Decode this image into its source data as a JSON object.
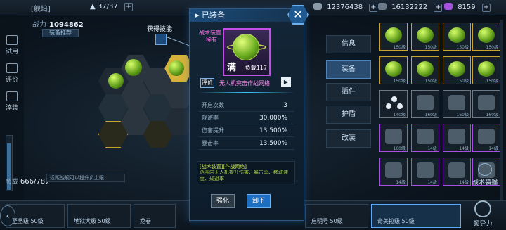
{
  "topbar": {
    "ship_name": "[舰坞]",
    "fleet_count": "37/37",
    "resources": [
      {
        "value": "12376438",
        "color": "#8a9aa8"
      },
      {
        "value": "16132222",
        "color": "#6b7b89"
      },
      {
        "value": "8159",
        "color": "#a64fe0"
      }
    ]
  },
  "left": {
    "nav": [
      "试用",
      "评价",
      "淬装"
    ],
    "power_label": "战力",
    "power_value": "1094862",
    "recommend_label": "装备推荐",
    "load_label": "负载",
    "load_value": "666/787",
    "load_fill_fraction": 0.85,
    "hint_text": "近距战舰可以提升负上限"
  },
  "skill": {
    "label": "获得技能",
    "icon": "skill-snowflake-icon"
  },
  "modal": {
    "title": "已装备",
    "card_type_line1": "战术装置",
    "card_type_line2": "稀有",
    "full_label": "满",
    "capacity_label": "负载117",
    "rate_label": "评价",
    "equipment_name": "无人机突击作战网络",
    "stats": [
      {
        "key": "开启次数",
        "value": "3"
      },
      {
        "key": "规避率",
        "value": "30.000%"
      },
      {
        "key": "伤害提升",
        "value": "13.500%"
      },
      {
        "key": "暴击率",
        "value": "13.500%"
      }
    ],
    "desc_title": "[战术装置][作战网络]",
    "desc_body": "范围内无人机提升伤害、暴击率、移动速度、规避率",
    "strengthen_label": "强化",
    "unequip_label": "卸下"
  },
  "tabs": [
    "信息",
    "装备",
    "插件",
    "护盾",
    "改装"
  ],
  "active_tab": "装备",
  "grid_slots": [
    {
      "type": "gold",
      "lvl": "150级"
    },
    {
      "type": "gold",
      "lvl": "150级"
    },
    {
      "type": "gold",
      "lvl": "150级"
    },
    {
      "type": "gold",
      "lvl": "150级"
    },
    {
      "type": "gold",
      "lvl": "150级"
    },
    {
      "type": "gold",
      "lvl": "150级"
    },
    {
      "type": "gold",
      "lvl": "150级"
    },
    {
      "type": "gold",
      "lvl": "150级"
    },
    {
      "type": "gray",
      "lvl": "140级"
    },
    {
      "type": "gray",
      "lvl": "160级"
    },
    {
      "type": "gray",
      "lvl": "160级"
    },
    {
      "type": "gray",
      "lvl": "160级"
    },
    {
      "type": "purple",
      "lvl": "160级"
    },
    {
      "type": "purple",
      "lvl": "14级"
    },
    {
      "type": "purple",
      "lvl": "14级"
    },
    {
      "type": "purple",
      "lvl": "14级"
    },
    {
      "type": "purple",
      "lvl": "14级"
    },
    {
      "type": "purple",
      "lvl": "14级"
    },
    {
      "type": "purple",
      "lvl": "14级"
    },
    {
      "type": "purple",
      "lvl": "14级"
    }
  ],
  "tactic_label": "战术装置",
  "ships": [
    {
      "name": "至坚级 50级"
    },
    {
      "name": "地狱犬级 50级"
    },
    {
      "name": "龙卷"
    },
    {
      "name": ""
    },
    {
      "name": ""
    },
    {
      "name": "启明号 50级"
    },
    {
      "name": "奇美拉级 50级"
    }
  ],
  "lead_label": "领导力"
}
